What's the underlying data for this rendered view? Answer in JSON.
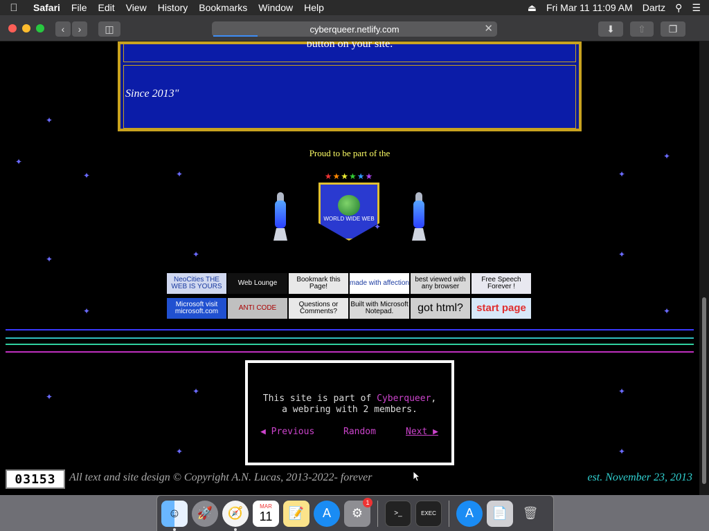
{
  "menubar": {
    "app": "Safari",
    "items": [
      "File",
      "Edit",
      "View",
      "History",
      "Bookmarks",
      "Window",
      "Help"
    ],
    "datetime": "Fri Mar 11  11:09 AM",
    "user": "Dartz"
  },
  "browser": {
    "url": "cyberqueer.netlify.com"
  },
  "page": {
    "top_box_text": "button on your site.",
    "since_text": "Since 2013\"",
    "proud_text": "Proud to be part of the",
    "www_badge_text": "WORLD WIDE WEB",
    "badges": [
      {
        "label": "NeoCities THE WEB IS YOURS",
        "bg": "#d0d8f0",
        "fg": "#1a3aa0"
      },
      {
        "label": "Web Lounge",
        "bg": "#111111",
        "fg": "#ffffff"
      },
      {
        "label": "Bookmark this Page!",
        "bg": "#e8e8e8",
        "fg": "#000000"
      },
      {
        "label": "made with affection",
        "bg": "#ffffff",
        "fg": "#1a3aa0"
      },
      {
        "label": "best viewed with any browser",
        "bg": "#d8d8d8",
        "fg": "#000000"
      },
      {
        "label": "Free Speech Forever !",
        "bg": "#e8e8f0",
        "fg": "#000000"
      },
      {
        "label": "Microsoft visit microsoft.com",
        "bg": "#2050d0",
        "fg": "#ffffff"
      },
      {
        "label": "ANTI CODE",
        "bg": "#c0c0c0",
        "fg": "#aa0000"
      },
      {
        "label": "Questions or Comments?",
        "bg": "#e8e8e8",
        "fg": "#000000"
      },
      {
        "label": "Built with Microsoft Notepad.",
        "bg": "#d8d8d8",
        "fg": "#000000"
      },
      {
        "label": "got html?",
        "bg": "#cfcfcf",
        "fg": "#000000"
      },
      {
        "label": "start page",
        "bg": "#d8e8f8",
        "fg": "#e03030"
      }
    ],
    "webring": {
      "line1_prefix": "This site is part of ",
      "ring_name": "Cyberqueer",
      "line1_suffix": ",",
      "line2": "a webring with 2 members.",
      "prev": "◀ Previous",
      "random": "Random",
      "next": "Next ▶"
    },
    "counter": "03153",
    "copyright": "All text and site design © Copyright A.N. Lucas, 2013-2022- forever",
    "est": "est. November 23, 2013"
  },
  "dock": {
    "calendar_month": "MAR",
    "calendar_day": "11",
    "settings_badge": "1"
  }
}
